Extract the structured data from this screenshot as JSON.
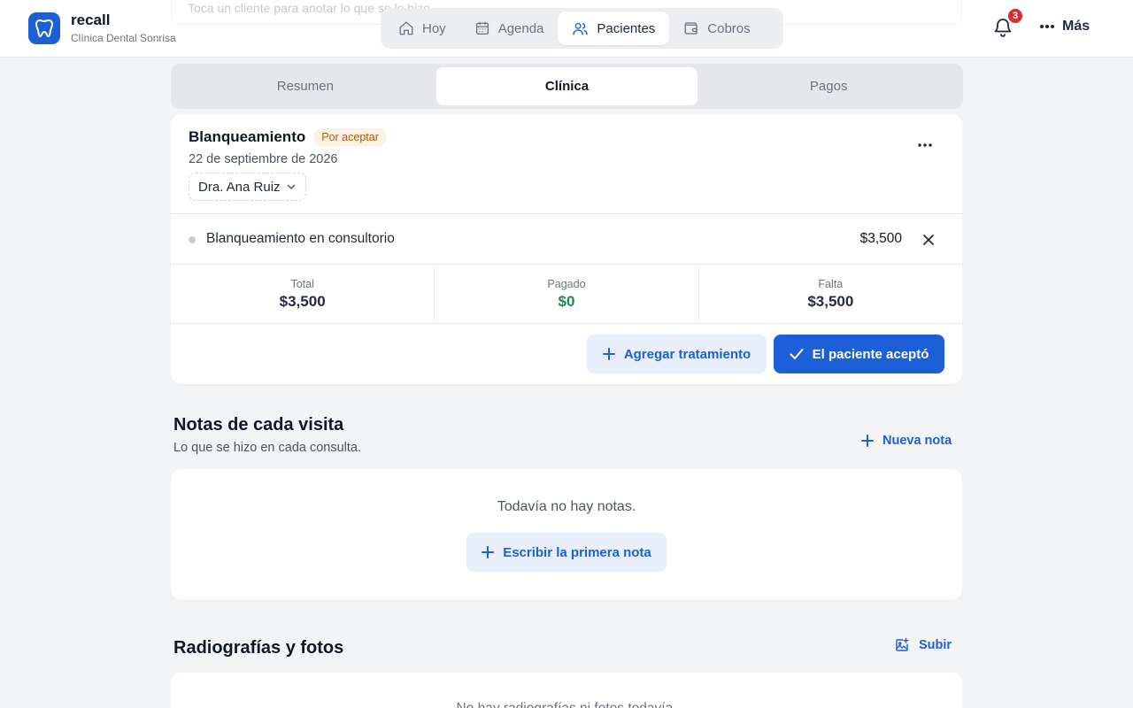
{
  "header": {
    "search_placeholder": "Toca un cliente para anotar lo que se le hizo",
    "brand_name": "recall",
    "brand_sub": "Clínica Dental Sonrisa",
    "nav": [
      {
        "label": "Hoy",
        "icon": "home-icon"
      },
      {
        "label": "Agenda",
        "icon": "calendar-icon"
      },
      {
        "label": "Pacientes",
        "icon": "users-icon",
        "active": true
      },
      {
        "label": "Cobros",
        "icon": "wallet-icon"
      }
    ],
    "notifications_count": "3",
    "more_label": "Más"
  },
  "tabs": [
    {
      "label": "Resumen"
    },
    {
      "label": "Clínica",
      "active": true
    },
    {
      "label": "Pagos"
    }
  ],
  "treatment": {
    "title": "Blanqueamiento",
    "status": "Por aceptar",
    "date": "22 de septiembre de 2026",
    "doctor": "Dra. Ana Ruiz",
    "items": [
      {
        "name": "Blanqueamiento en consultorio",
        "price": "$3,500"
      }
    ],
    "totals": {
      "total_label": "Total",
      "total_value": "$3,500",
      "paid_label": "Pagado",
      "paid_value": "$0",
      "due_label": "Falta",
      "due_value": "$3,500"
    },
    "add_button": "Agregar tratamiento",
    "accept_button": "El paciente aceptó"
  },
  "notes": {
    "title": "Notas de cada visita",
    "subtitle": "Lo que se hizo en cada consulta.",
    "new_note": "Nueva nota",
    "empty": "Todavía no hay notas.",
    "first_note_button": "Escribir la primera nota"
  },
  "photos": {
    "title": "Radiografías y fotos",
    "upload": "Subir",
    "empty": "No hay radiografías ni fotos todavía."
  },
  "colors": {
    "accent": "#1d5fd6",
    "badge_bg": "#fdf1e3",
    "badge_fg": "#a75a14",
    "paid_green": "#1c8a4e",
    "notification_red": "#d92d2d"
  }
}
